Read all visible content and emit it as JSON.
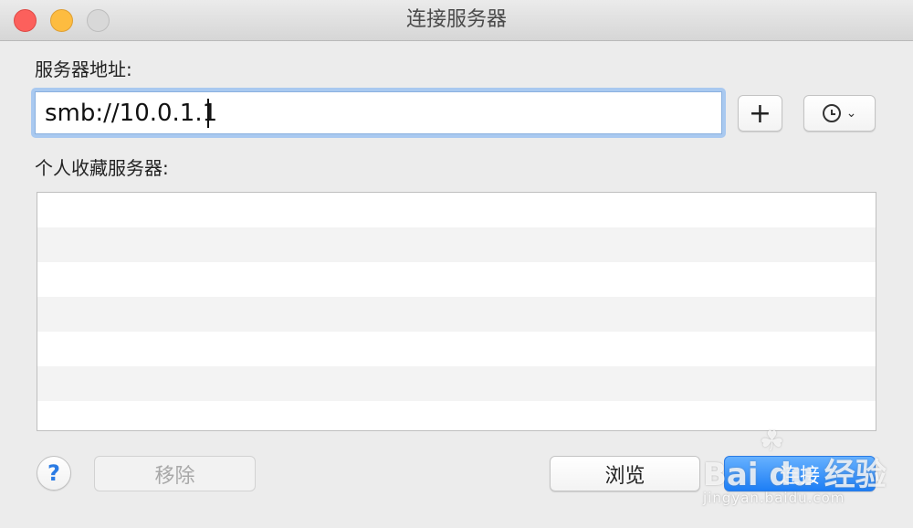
{
  "window": {
    "title": "连接服务器"
  },
  "form": {
    "address_label": "服务器地址:",
    "address_value": "smb://10.0.1.1",
    "add_label": "+",
    "favorites_label": "个人收藏服务器:"
  },
  "buttons": {
    "help": "?",
    "remove": "移除",
    "browse": "浏览",
    "connect": "连接"
  },
  "favorites": [],
  "watermark": {
    "main": "Bai du 经验",
    "sub": "jingyan.baidu.com"
  },
  "colors": {
    "close": "#fc605c",
    "minimize": "#fdbc40",
    "zoom": "#d8d8d8",
    "accent": "#1d7ef5"
  },
  "icons": {
    "recent_servers": "clock-icon",
    "recent_menu": "chevron-down-icon"
  }
}
